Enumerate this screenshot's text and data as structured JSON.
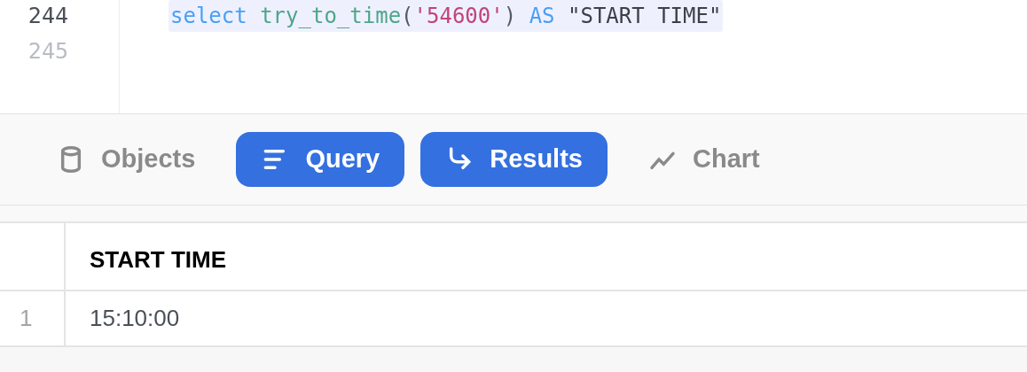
{
  "editor": {
    "lines": [
      {
        "number": "244",
        "active": true,
        "tokens": [
          {
            "kind": "keyword",
            "text": "select "
          },
          {
            "kind": "function",
            "text": "try_to_time"
          },
          {
            "kind": "punct",
            "text": "("
          },
          {
            "kind": "string",
            "text": "'54600'"
          },
          {
            "kind": "punct",
            "text": ") "
          },
          {
            "kind": "keyword",
            "text": "AS "
          },
          {
            "kind": "plain",
            "text": "\"START TIME\""
          }
        ]
      },
      {
        "number": "245",
        "active": false
      }
    ]
  },
  "tabs": [
    {
      "label": "Objects",
      "kind": "database",
      "selected": false
    },
    {
      "label": "Query",
      "kind": "lines",
      "selected": true
    },
    {
      "label": "Results",
      "kind": "turn",
      "selected": true
    },
    {
      "label": "Chart",
      "kind": "trend",
      "selected": false
    }
  ],
  "table": {
    "columns": [
      "START TIME"
    ],
    "rows": [
      {
        "index": "1",
        "cells": [
          "15:10:00"
        ]
      }
    ]
  }
}
